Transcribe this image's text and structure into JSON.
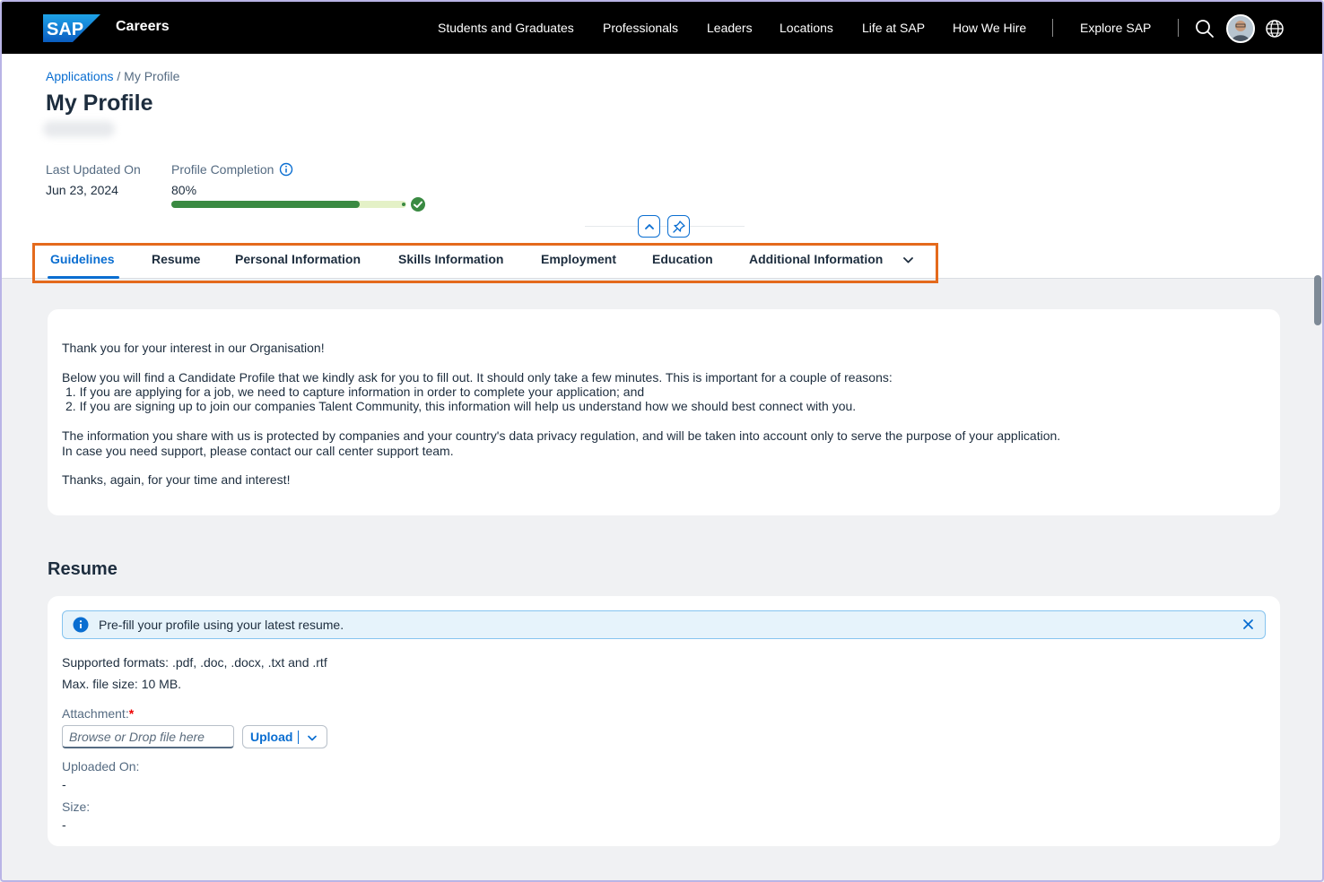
{
  "topbar": {
    "logo_text": "SAP",
    "brand": "Careers",
    "nav": [
      {
        "label": "Students and Graduates"
      },
      {
        "label": "Professionals"
      },
      {
        "label": "Leaders"
      },
      {
        "label": "Locations"
      },
      {
        "label": "Life at SAP"
      },
      {
        "label": "How We Hire"
      },
      {
        "label": "Explore SAP"
      }
    ],
    "icons": [
      "search-icon",
      "avatar",
      "globe-icon"
    ]
  },
  "breadcrumb": {
    "link": "Applications",
    "separator": "/",
    "current": "My Profile"
  },
  "page_title": "My Profile",
  "meta": {
    "last_updated_label": "Last Updated On",
    "last_updated_value": "Jun 23, 2024",
    "completion_label": "Profile Completion",
    "completion_value": "80%",
    "completion_fraction": 0.8
  },
  "tabs": [
    {
      "label": "Guidelines",
      "active": true
    },
    {
      "label": "Resume"
    },
    {
      "label": "Personal Information"
    },
    {
      "label": "Skills Information"
    },
    {
      "label": "Employment"
    },
    {
      "label": "Education"
    },
    {
      "label": "Additional Information"
    }
  ],
  "guidelines": {
    "intro": "Thank you for your interest in our Organisation!",
    "para1": "Below you will find a Candidate Profile that we kindly ask for you to fill out. It should only take a few minutes. This is important for a couple of reasons:",
    "item1": "1.  If you are applying for a job, we need to capture information in order to complete your application; and",
    "item2": "2.  If you are signing up to join our companies Talent Community, this information will help us understand how we should best connect with you.",
    "para2": "The information you share with us is protected by companies and your country's data privacy regulation, and will be taken into account only to serve the purpose of your application.",
    "para3": "In case you need support, please contact our call center support team.",
    "closing": "Thanks, again, for your time and interest!"
  },
  "resume": {
    "title": "Resume",
    "info_strip": "Pre-fill your profile using your latest resume.",
    "formats": "Supported formats: .pdf, .doc, .docx, .txt and .rtf",
    "max_size": "Max. file size: 10 MB.",
    "attachment_label": "Attachment:",
    "required_mark": "*",
    "file_placeholder": "Browse or Drop file here",
    "upload_label": "Upload",
    "uploaded_on_label": "Uploaded On:",
    "uploaded_on_value": "-",
    "size_label": "Size:",
    "size_value": "-"
  },
  "colors": {
    "accent": "#0a6ed1",
    "progress": "#3a8a42",
    "highlight_box": "#e46a1c"
  }
}
